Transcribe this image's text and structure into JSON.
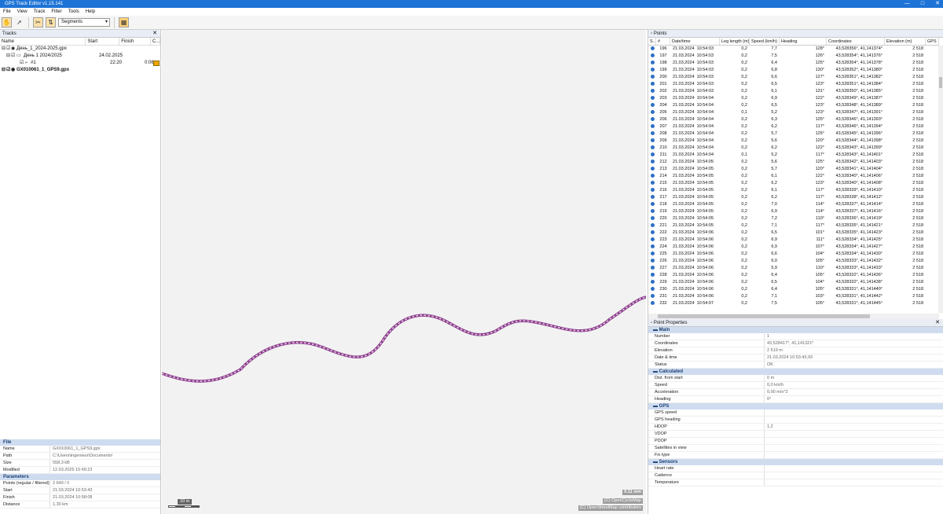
{
  "window": {
    "title": "GPS Track Editor v1.15.141",
    "minimize": "—",
    "maximize": "□"
  },
  "menu": [
    "File",
    "View",
    "Track",
    "Filter",
    "Tools",
    "Help"
  ],
  "toolbar": {
    "mode_select": "Segments"
  },
  "tracks_panel": {
    "title": "Tracks",
    "columns": [
      "Name",
      "Start",
      "Finish",
      "C..."
    ],
    "items": [
      {
        "name": "День_1_2024-2025.gpx",
        "start": "",
        "finish": ""
      },
      {
        "name": "День 1 2024/2025",
        "start": "24.02.2025",
        "finish": ""
      },
      {
        "name": "#1",
        "start": "22:20",
        "finish": "0:06"
      },
      {
        "name": "GX010061_1_GPS9.gpx",
        "start": "",
        "finish": ""
      }
    ],
    "swatch_color": "#f0a500"
  },
  "file_panel": {
    "file_header": "File",
    "file_rows": [
      {
        "key": "Name",
        "value": "GX010061_1_GPS9.gpx"
      },
      {
        "key": "Path",
        "value": "C:\\Users\\ingenieur\\Documents\\"
      },
      {
        "key": "Size",
        "value": "558,3 kB"
      },
      {
        "key": "Modified",
        "value": "12.03.2025 15:49:23"
      }
    ],
    "params_header": "Parameters",
    "param_rows": [
      {
        "key": "Points (regular / filtered)",
        "value": "2 649 / 0"
      },
      {
        "key": "Start",
        "value": "21.03.2024 10:53:43"
      },
      {
        "key": "Finish",
        "value": "21.03.2024 10:58:08"
      },
      {
        "key": "Distance",
        "value": "1,30 km"
      }
    ]
  },
  "map": {
    "scale_label": "10 m",
    "zoom_label": "0.11 mm",
    "credit1": "(C) OpenCycleMap",
    "credit2": "(C) OpenStreetMap contributors",
    "track_color": "#8c3f8c",
    "track_points_color": "#e6c8e6"
  },
  "points_panel": {
    "title": "Points",
    "columns": [
      "S...",
      "#",
      "Date/time",
      "Leg length (m)",
      "Speed (km/h)",
      "Heading",
      "Coordinates",
      "Elevation (m)",
      "GPS"
    ],
    "rows": [
      [
        "196",
        "21.03.2024",
        "10:54:03",
        "0,2",
        "7,7",
        "128°",
        "43,528356°, 41,141374°",
        "2 518"
      ],
      [
        "197",
        "21.03.2024",
        "10:54:03",
        "0,2",
        "7,5",
        "126°",
        "43,528354°, 41,141376°",
        "2 518"
      ],
      [
        "198",
        "21.03.2024",
        "10:54:03",
        "0,2",
        "6,4",
        "125°",
        "43,528354°, 41,141378°",
        "2 518"
      ],
      [
        "199",
        "21.03.2024",
        "10:54:03",
        "0,2",
        "6,8",
        "130°",
        "43,528352°, 41,141380°",
        "2 518"
      ],
      [
        "200",
        "21.03.2024",
        "10:54:03",
        "0,2",
        "6,6",
        "127°",
        "43,528351°, 41,141382°",
        "2 518"
      ],
      [
        "201",
        "21.03.2024",
        "10:54:03",
        "0,2",
        "6,5",
        "123°",
        "43,528351°, 41,141384°",
        "2 518"
      ],
      [
        "202",
        "21.03.2024",
        "10:54:03",
        "0,2",
        "6,1",
        "131°",
        "43,528350°, 41,141385°",
        "2 518"
      ],
      [
        "203",
        "21.03.2024",
        "10:54:04",
        "0,2",
        "6,9",
        "122°",
        "43,528349°, 41,141387°",
        "2 518"
      ],
      [
        "204",
        "21.03.2024",
        "10:54:04",
        "0,2",
        "6,5",
        "123°",
        "43,528348°, 41,141389°",
        "2 518"
      ],
      [
        "205",
        "21.03.2024",
        "10:54:04",
        "0,1",
        "5,2",
        "123°",
        "43,528347°, 41,141391°",
        "2 518"
      ],
      [
        "206",
        "21.03.2024",
        "10:54:04",
        "0,2",
        "6,3",
        "125°",
        "43,528346°, 41,141393°",
        "2 518"
      ],
      [
        "207",
        "21.03.2024",
        "10:54:04",
        "0,2",
        "6,2",
        "117°",
        "43,528346°, 41,141394°",
        "2 518"
      ],
      [
        "208",
        "21.03.2024",
        "10:54:04",
        "0,2",
        "5,7",
        "125°",
        "43,528345°, 41,141396°",
        "2 518"
      ],
      [
        "209",
        "21.03.2024",
        "10:54:04",
        "0,2",
        "5,6",
        "120°",
        "43,528344°, 41,141398°",
        "2 518"
      ],
      [
        "210",
        "21.03.2024",
        "10:54:04",
        "0,2",
        "6,2",
        "122°",
        "43,528343°, 41,141399°",
        "2 518"
      ],
      [
        "211",
        "21.03.2024",
        "10:54:04",
        "0,1",
        "5,2",
        "117°",
        "43,528343°, 41,141401°",
        "2 518"
      ],
      [
        "212",
        "21.03.2024",
        "10:54:05",
        "0,2",
        "5,6",
        "125°",
        "43,528342°, 41,141403°",
        "2 518"
      ],
      [
        "213",
        "21.03.2024",
        "10:54:05",
        "0,2",
        "5,7",
        "120°",
        "43,528341°, 41,141404°",
        "2 518"
      ],
      [
        "214",
        "21.03.2024",
        "10:54:05",
        "0,2",
        "6,1",
        "122°",
        "43,528340°, 41,141406°",
        "2 518"
      ],
      [
        "215",
        "21.03.2024",
        "10:54:05",
        "0,2",
        "6,2",
        "123°",
        "43,528340°, 41,141408°",
        "2 518"
      ],
      [
        "216",
        "21.03.2024",
        "10:54:05",
        "0,2",
        "6,1",
        "117°",
        "43,528339°, 41,141410°",
        "2 518"
      ],
      [
        "217",
        "21.03.2024",
        "10:54:05",
        "0,2",
        "6,2",
        "117°",
        "43,528338°, 41,141412°",
        "2 518"
      ],
      [
        "218",
        "21.03.2024",
        "10:54:05",
        "0,2",
        "7,0",
        "114°",
        "43,528337°, 41,141414°",
        "2 518"
      ],
      [
        "219",
        "21.03.2024",
        "10:54:05",
        "0,2",
        "6,9",
        "114°",
        "43,528337°, 41,141416°",
        "2 518"
      ],
      [
        "220",
        "21.03.2024",
        "10:54:05",
        "0,2",
        "7,2",
        "110°",
        "43,528336°, 41,141419°",
        "2 518"
      ],
      [
        "221",
        "21.03.2024",
        "10:54:05",
        "0,2",
        "7,1",
        "117°",
        "43,528335°, 41,141421°",
        "2 518"
      ],
      [
        "222",
        "21.03.2024",
        "10:54:06",
        "0,2",
        "6,5",
        "101°",
        "43,528335°, 41,141423°",
        "2 518"
      ],
      [
        "223",
        "21.03.2024",
        "10:54:06",
        "0,2",
        "6,9",
        "111°",
        "43,528334°, 41,141425°",
        "2 518"
      ],
      [
        "224",
        "21.03.2024",
        "10:54:06",
        "0,2",
        "6,9",
        "107°",
        "43,528334°, 41,141427°",
        "2 518"
      ],
      [
        "225",
        "21.03.2024",
        "10:54:06",
        "0,2",
        "6,6",
        "104°",
        "43,528334°, 41,141430°",
        "2 518"
      ],
      [
        "226",
        "21.03.2024",
        "10:54:06",
        "0,2",
        "6,0",
        "105°",
        "43,528333°, 41,141432°",
        "2 518"
      ],
      [
        "227",
        "21.03.2024",
        "10:54:06",
        "0,2",
        "5,9",
        "110°",
        "43,528333°, 41,141433°",
        "2 518"
      ],
      [
        "228",
        "21.03.2024",
        "10:54:06",
        "0,2",
        "6,4",
        "105°",
        "43,528332°, 41,141436°",
        "2 518"
      ],
      [
        "229",
        "21.03.2024",
        "10:54:06",
        "0,2",
        "6,5",
        "104°",
        "43,528332°, 41,141438°",
        "2 518"
      ],
      [
        "230",
        "21.03.2024",
        "10:54:06",
        "0,2",
        "6,4",
        "105°",
        "43,528331°, 41,141440°",
        "2 518"
      ],
      [
        "231",
        "21.03.2024",
        "10:54:06",
        "0,2",
        "7,1",
        "103°",
        "43,528331°, 41,141442°",
        "2 518"
      ],
      [
        "232",
        "21.03.2024",
        "10:54:07",
        "0,2",
        "7,5",
        "105°",
        "43,528331°, 41,141445°",
        "2 518"
      ]
    ]
  },
  "point_props": {
    "title": "Point Properties",
    "sections": [
      {
        "name": "Main",
        "rows": [
          {
            "key": "Number",
            "value": "1"
          },
          {
            "key": "Coordinates",
            "value": "43,528417°, 41,141321°"
          },
          {
            "key": "Elevation",
            "value": "2 519 m"
          },
          {
            "key": "Date & time",
            "value": "21.03.2024 10:53:43,93"
          },
          {
            "key": "Status",
            "value": "OK"
          }
        ]
      },
      {
        "name": "Calculated",
        "rows": [
          {
            "key": "Dist. from start",
            "value": "0 m"
          },
          {
            "key": "Speed",
            "value": "0,0 km/h"
          },
          {
            "key": "Acceleration",
            "value": "0,00 m/s^2"
          },
          {
            "key": "Heading",
            "value": "0°"
          }
        ]
      },
      {
        "name": "GPS",
        "rows": [
          {
            "key": "GPS speed",
            "value": ""
          },
          {
            "key": "GPS heading",
            "value": ""
          },
          {
            "key": "HDOP",
            "value": "1,2"
          },
          {
            "key": "VDOP",
            "value": ""
          },
          {
            "key": "PDOP",
            "value": ""
          },
          {
            "key": "Satellites in view",
            "value": ""
          },
          {
            "key": "Fix type",
            "value": ""
          }
        ]
      },
      {
        "name": "Sensors",
        "rows": [
          {
            "key": "Heart rate",
            "value": ""
          },
          {
            "key": "Cadence",
            "value": ""
          },
          {
            "key": "Temperature",
            "value": ""
          }
        ]
      }
    ]
  }
}
